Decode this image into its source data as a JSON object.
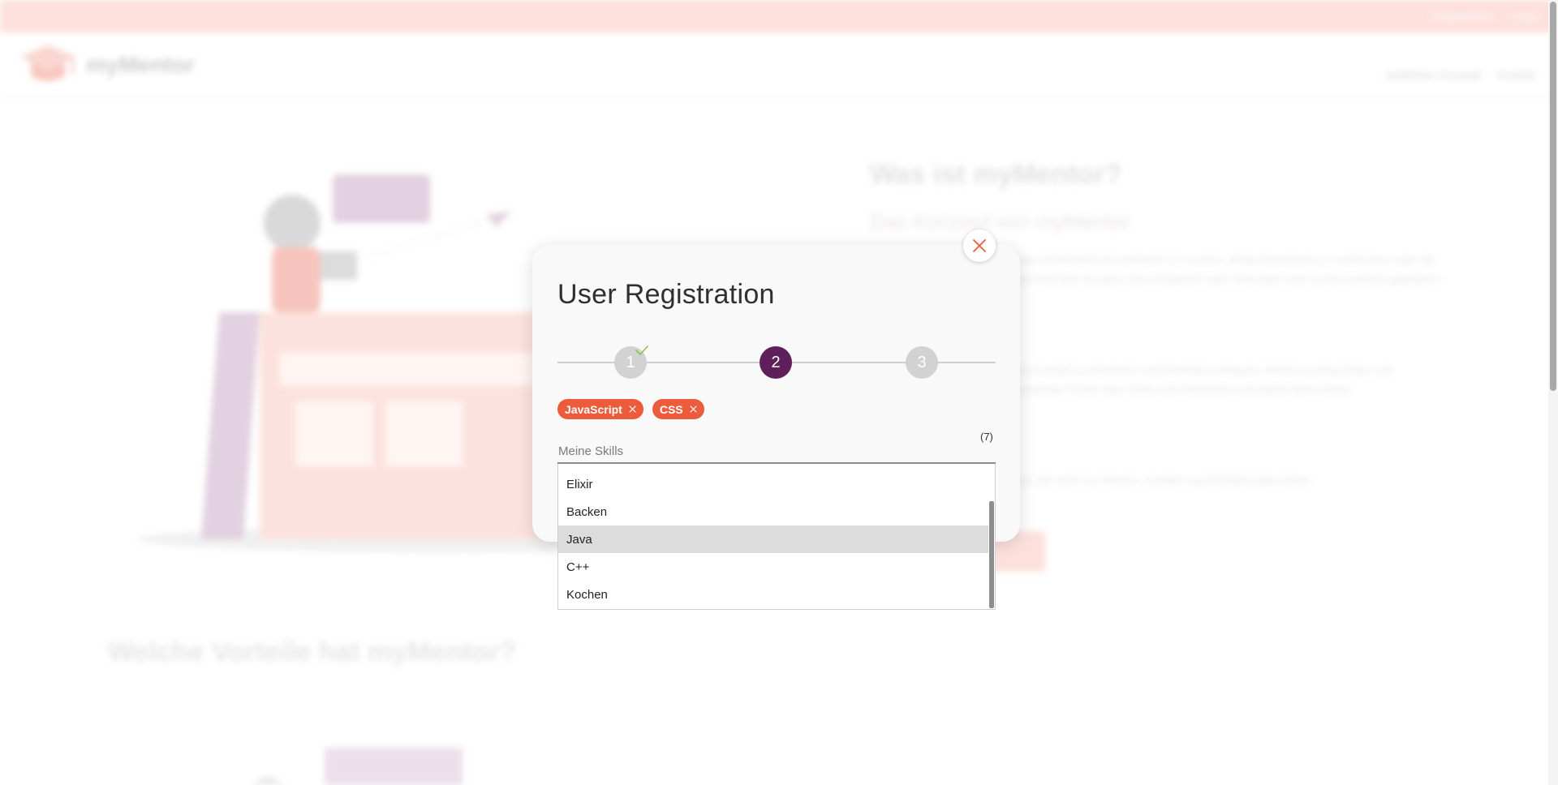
{
  "background": {
    "topbar_links": [
      "Registrieren",
      "Login"
    ],
    "logo_text": "myMentor",
    "nav_links": [
      "myMentor Konzept",
      "Kontakt"
    ],
    "hero_title": "Was ist myMentor?",
    "hero_subtitle": "Das Konzept von myMentor",
    "paragraphs": [
      "Studenten und Partner, die in der Arbeitswelt mit myMentor Zu suchen, deine Kenntnisse zu verbessern oder die nächste Stelle für Person? Oder möchtest du beim Job erfolgreich sein? Wie kann man Lernen wirklich gestalten?",
      "Mit myMentor kannst du einfach Kontakt zu Mentoren und Mentees aufbauen, Wissen austauschen und gemeinsam wachsen. Finde passende Profile über Skills und Interessen und starte deine Reise.",
      "Lerne gemeinsam mit Mentoren, die nicht nur Wissen, sondern auch Erfahrungen teilen."
    ],
    "section_title": "Welche Vorteile hat myMentor?"
  },
  "modal": {
    "title": "User Registration",
    "close_label": "Schließen",
    "steps": [
      {
        "label": "1",
        "state": "completed"
      },
      {
        "label": "2",
        "state": "active"
      },
      {
        "label": "3",
        "state": "upcoming"
      }
    ],
    "selected_skills": [
      "JavaScript",
      "CSS"
    ],
    "skills_counter": "(7)",
    "skills_input": {
      "placeholder": "Meine Skills",
      "value": ""
    },
    "dropdown_options": [
      "Elixir",
      "Backen",
      "Java",
      "C++",
      "Kochen"
    ],
    "highlighted_option": "Java"
  },
  "colors": {
    "accent": "#ec5b3c",
    "active_step": "#5e1f5a",
    "inactive_step": "#d2d2d2",
    "check": "#8bc34a"
  }
}
